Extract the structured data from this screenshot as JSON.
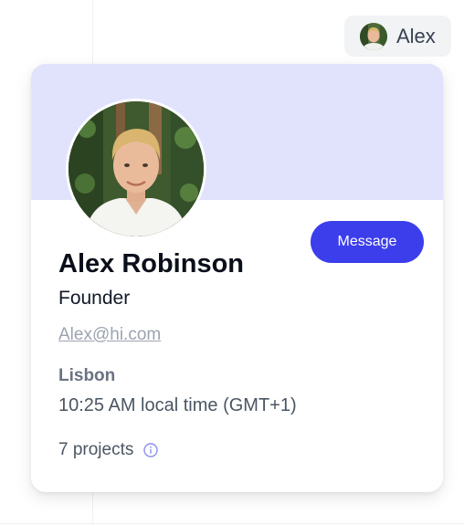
{
  "user_chip": {
    "name": "Alex",
    "avatar_icon": "user-avatar-photo"
  },
  "profile_card": {
    "banner_color": "#e0e3fb",
    "avatar_icon": "user-avatar-photo",
    "message_button": "Message",
    "name": "Alex Robinson",
    "role": "Founder",
    "email": "Alex@hi.com",
    "location": "Lisbon",
    "local_time": "10:25 AM local time (GMT+1)",
    "projects": "7 projects",
    "projects_info_icon": "info-icon"
  },
  "colors": {
    "accent": "#3b3eea",
    "banner": "#e0e3fb",
    "muted_text": "#6b7280"
  }
}
